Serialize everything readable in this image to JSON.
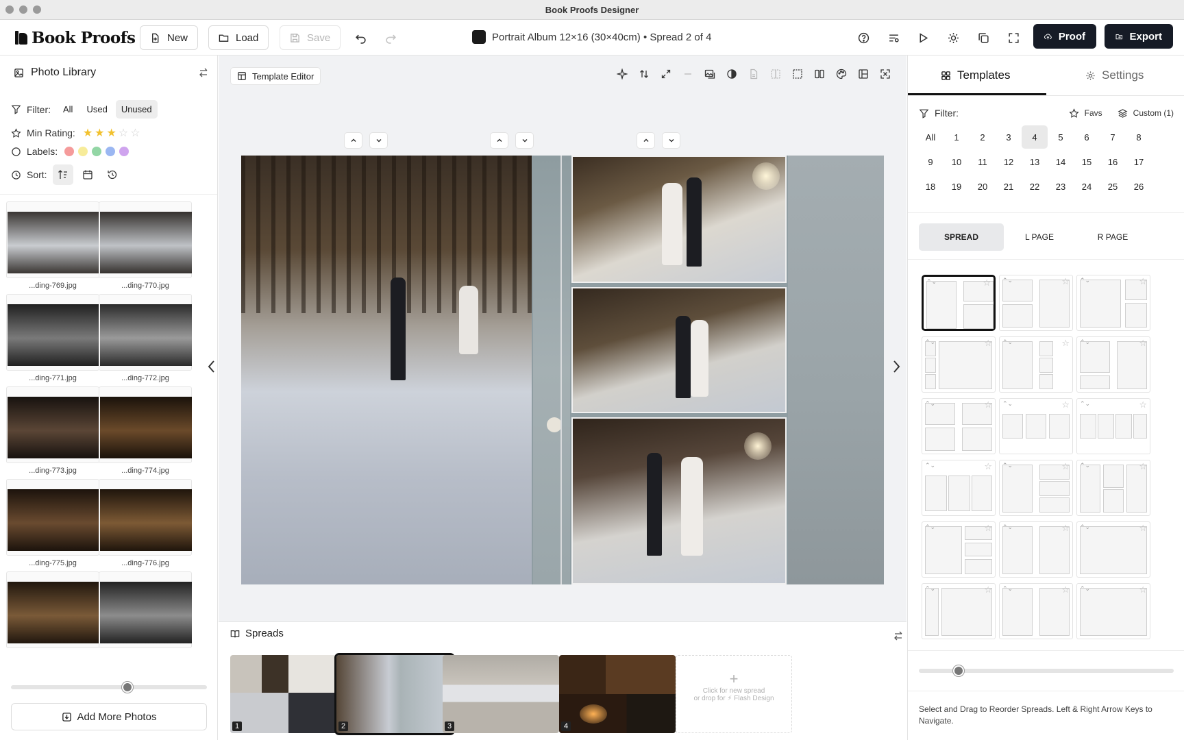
{
  "window": {
    "title": "Book Proofs Designer"
  },
  "toolbar": {
    "logo_text": "Book Proofs",
    "new_label": "New",
    "load_label": "Load",
    "save_label": "Save",
    "document_title": "Portrait Album 12×16 (30×40cm) • Spread 2 of 4",
    "proof_label": "Proof",
    "export_label": "Export"
  },
  "library": {
    "title": "Photo Library",
    "filter_label": "Filter:",
    "filters": [
      "All",
      "Used",
      "Unused"
    ],
    "active_filter": "Unused",
    "min_rating_label": "Min Rating:",
    "rating": 3,
    "rating_max": 5,
    "labels_label": "Labels:",
    "label_colors": [
      "#f59b9b",
      "#f7ec9a",
      "#93d6a5",
      "#9bb7f2",
      "#cfa4ee"
    ],
    "sort_label": "Sort:",
    "photos": [
      {
        "name": "...ding-769.jpg",
        "tone": [
          "#c9ccd0",
          "#3a3633"
        ]
      },
      {
        "name": "...ding-770.jpg",
        "tone": [
          "#bfc2c6",
          "#35312e"
        ]
      },
      {
        "name": "...ding-771.jpg",
        "tone": [
          "#7a7a7a",
          "#202020"
        ]
      },
      {
        "name": "...ding-772.jpg",
        "tone": [
          "#9a9a9a",
          "#2b2b2b"
        ]
      },
      {
        "name": "...ding-773.jpg",
        "tone": [
          "#5b4636",
          "#17120f"
        ]
      },
      {
        "name": "...ding-774.jpg",
        "tone": [
          "#6b4a2a",
          "#1a120b"
        ]
      },
      {
        "name": "...ding-775.jpg",
        "tone": [
          "#6a4b30",
          "#1c130c"
        ]
      },
      {
        "name": "...ding-776.jpg",
        "tone": [
          "#7d5a35",
          "#1f150c"
        ]
      },
      {
        "name": "",
        "tone": [
          "#7a5a38",
          "#21170e"
        ]
      },
      {
        "name": "",
        "tone": [
          "#8c8c8c",
          "#222222"
        ]
      }
    ],
    "thumb_size": 0.6,
    "add_more_label": "Add More Photos"
  },
  "editor": {
    "template_editor_label": "Template Editor"
  },
  "spreads": {
    "title": "Spreads",
    "items": [
      {
        "number": "1",
        "selected": false
      },
      {
        "number": "2",
        "selected": true
      },
      {
        "number": "3",
        "selected": false
      },
      {
        "number": "4",
        "selected": false
      }
    ],
    "new_spread_line1": "Click for new spread",
    "new_spread_line2": "or drop for ⚡ Flash Design"
  },
  "templates": {
    "tab_templates": "Templates",
    "tab_settings": "Settings",
    "filter_label": "Filter:",
    "favs_label": "Favs",
    "custom_label": "Custom (1)",
    "counts": [
      "All",
      "1",
      "2",
      "3",
      "4",
      "5",
      "6",
      "7",
      "8",
      "9",
      "10",
      "11",
      "12",
      "13",
      "14",
      "15",
      "16",
      "17",
      "18",
      "19",
      "20",
      "21",
      "22",
      "23",
      "24",
      "25",
      "26"
    ],
    "active_count": "4",
    "segments": [
      "SPREAD",
      "L PAGE",
      "R PAGE"
    ],
    "active_segment": "SPREAD",
    "size_level": 0.14,
    "hint": "Select and Drag to Reorder Spreads. Left & Right Arrow Keys to Navigate."
  },
  "colors": {
    "accent_dark": "#161b26",
    "star_filled": "#f2c12e",
    "star_empty": "#cfcfcf"
  }
}
